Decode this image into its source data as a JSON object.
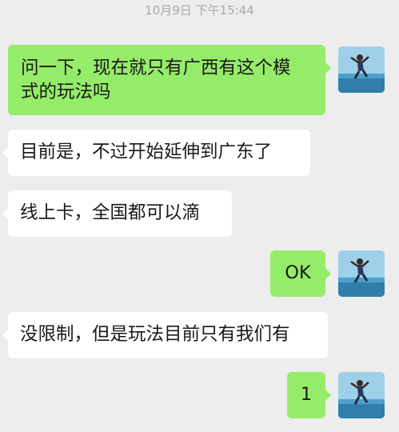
{
  "timestamp": "10月9日 下午15:44",
  "messages": [
    {
      "dir": "out",
      "text": "问一下，现在就只有广西有这个模式的玩法吗",
      "line1": "问一下，现在就只有广西有这个模",
      "line2": "式的玩法吗"
    },
    {
      "dir": "in",
      "text": "目前是，不过开始延伸到广东了"
    },
    {
      "dir": "in",
      "text": "线上卡，全国都可以滴"
    },
    {
      "dir": "out",
      "text": "OK"
    },
    {
      "dir": "in",
      "text": "没限制，但是玩法目前只有我们有"
    },
    {
      "dir": "out",
      "text": "1"
    }
  ],
  "colors": {
    "outgoing": "#95ec69",
    "incoming": "#ffffff",
    "background": "#ededed"
  },
  "avatar_icon": "jumping-person-avatar"
}
